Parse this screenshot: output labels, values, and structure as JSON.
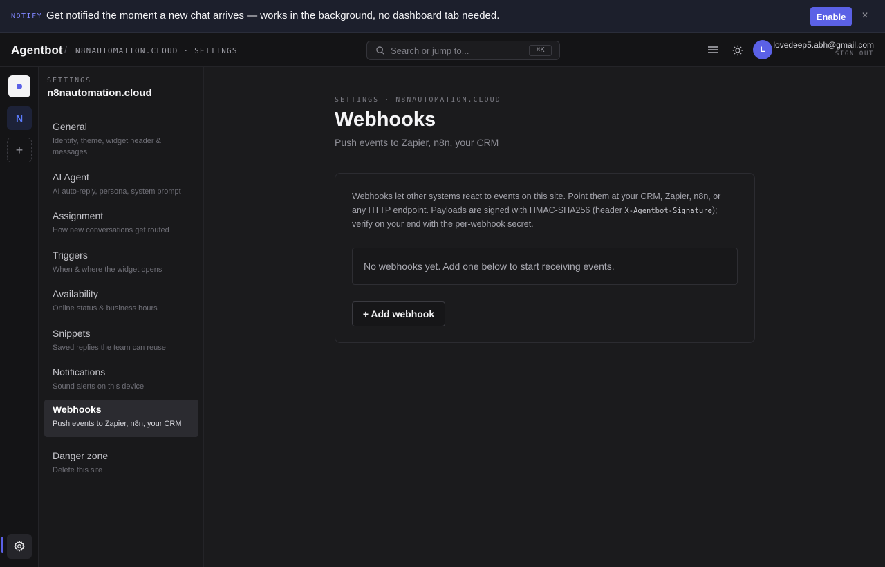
{
  "banner": {
    "tag": "NOTIFY",
    "message": "Get notified the moment a new chat arrives — works in the background, no dashboard tab needed.",
    "enable_label": "Enable",
    "close_icon": "×"
  },
  "topbar": {
    "brand": "Agentbot",
    "separator": "/",
    "crumb": "N8NAUTOMATION.CLOUD · SETTINGS",
    "search_placeholder": "Search or jump to...",
    "search_shortcut": "⌘K",
    "user_initial": "L",
    "user_email": "lovedeep5.abh@gmail.com",
    "sign_out": "SIGN OUT"
  },
  "rail": {
    "site_initial": "N",
    "add_icon": "+"
  },
  "sidebar": {
    "eyebrow": "SETTINGS",
    "site_name": "n8nautomation.cloud",
    "items": [
      {
        "label": "General",
        "sub": "Identity, theme, widget header & messages"
      },
      {
        "label": "AI Agent",
        "sub": "AI auto-reply, persona, system prompt"
      },
      {
        "label": "Assignment",
        "sub": "How new conversations get routed"
      },
      {
        "label": "Triggers",
        "sub": "When & where the widget opens"
      },
      {
        "label": "Availability",
        "sub": "Online status & business hours"
      },
      {
        "label": "Snippets",
        "sub": "Saved replies the team can reuse"
      },
      {
        "label": "Notifications",
        "sub": "Sound alerts on this device"
      },
      {
        "label": "Webhooks",
        "sub": "Push events to Zapier, n8n, your CRM"
      },
      {
        "label": "Danger zone",
        "sub": "Delete this site"
      }
    ],
    "active_index": 7
  },
  "main": {
    "crumb": "SETTINGS · N8NAUTOMATION.CLOUD",
    "title": "Webhooks",
    "subtitle": "Push events to Zapier, n8n, your CRM",
    "desc_part1": "Webhooks let other systems react to events on this site. Point them at your CRM, Zapier, n8n, or any HTTP endpoint. Payloads are signed with HMAC-SHA256 (header ",
    "desc_code": "X-Agentbot-Signature",
    "desc_part2": "); verify on your end with the per-webhook secret.",
    "empty_state": "No webhooks yet. Add one below to start receiving events.",
    "add_button": "+ Add webhook"
  },
  "colors": {
    "accent": "#5b61e6",
    "background": "#1b1b1d",
    "sidebar": "#19191b",
    "banner": "#1c1f2c"
  }
}
